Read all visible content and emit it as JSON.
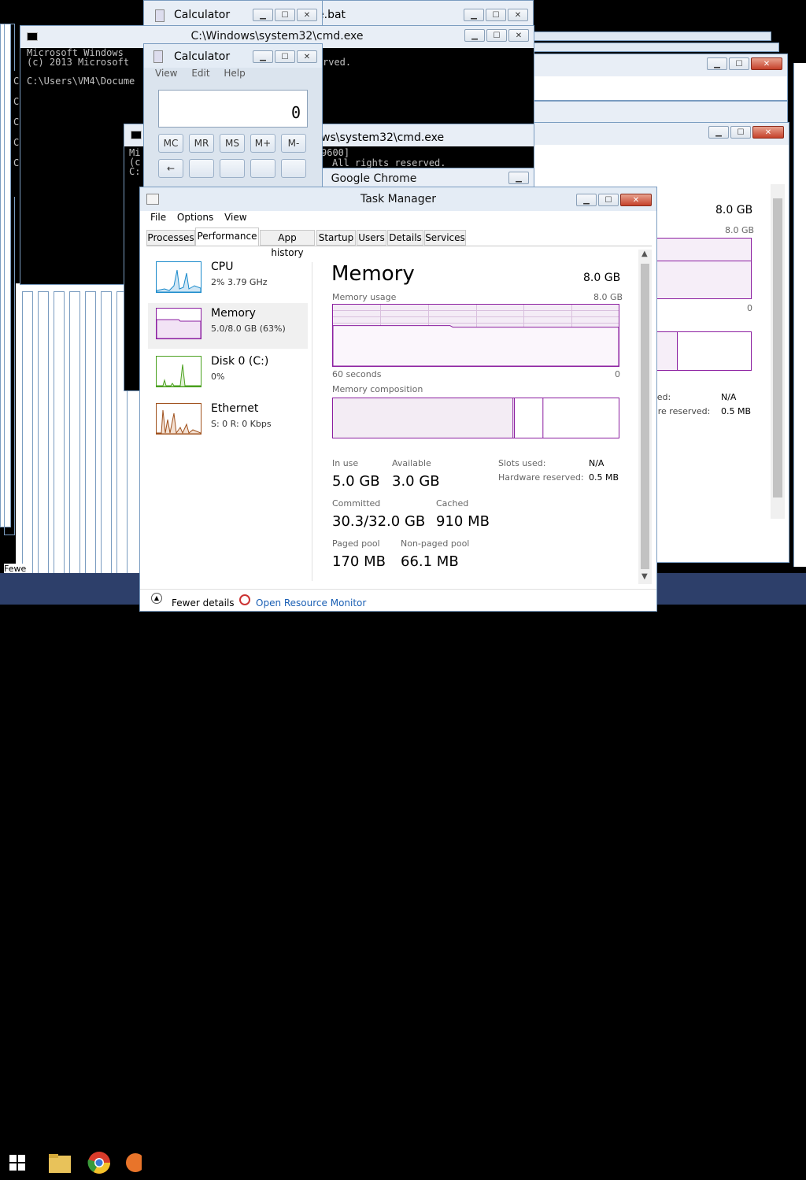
{
  "colors": {
    "accent": "#8b1ea0",
    "cpu": "#1a8acb",
    "disk": "#4aa01e",
    "ethernet": "#a0521e"
  },
  "background_windows": {
    "calc_back_title": "Calculator",
    "bat_title_fragment": "e.bat",
    "cmd1_title": "C:\\Windows\\system32\\cmd.exe",
    "cmd1_lines": [
      "Microsoft Windows",
      "(c) 2013 Microsoft",
      "",
      "C:\\Users\\VM4\\Docume"
    ],
    "cmd1_line2_tail": "rved.",
    "left_column_letters": [
      "C",
      "C",
      "C",
      "C",
      "C"
    ],
    "cmd2_title_fragment": "ws\\system32\\cmd.exe",
    "cmd2_lines": [
      "Mi",
      "(c",
      "C:"
    ],
    "cmd2_tail_1": "9600]",
    "cmd2_tail_2": "All rights reserved.",
    "chrome_title": "Google Chrome",
    "fewe_fragment": "Fewe",
    "right_tm": {
      "total": "8.0 GB",
      "max": "8.0 GB",
      "zero": "0",
      "slots_label": "sed:",
      "slots_value": "N/A",
      "hw_label": "are reserved:",
      "hw_value": "0.5 MB"
    }
  },
  "calculator": {
    "title": "Calculator",
    "menu": [
      "View",
      "Edit",
      "Help"
    ],
    "display": "0",
    "memory_buttons": [
      "MC",
      "MR",
      "MS",
      "M+",
      "M-"
    ],
    "back_button": "←"
  },
  "task_manager": {
    "title": "Task Manager",
    "menu": [
      "File",
      "Options",
      "View"
    ],
    "tabs": [
      "Processes",
      "Performance",
      "App history",
      "Startup",
      "Users",
      "Details",
      "Services"
    ],
    "active_tab": "Performance",
    "sidebar": [
      {
        "name": "CPU",
        "sub": "2%  3.79 GHz"
      },
      {
        "name": "Memory",
        "sub": "5.0/8.0 GB (63%)"
      },
      {
        "name": "Disk 0 (C:)",
        "sub": "0%"
      },
      {
        "name": "Ethernet",
        "sub": "S: 0  R: 0 Kbps"
      }
    ],
    "detail": {
      "heading": "Memory",
      "total": "8.0 GB",
      "usage_label": "Memory usage",
      "usage_max": "8.0 GB",
      "time_left": "60 seconds",
      "time_right": "0",
      "usage_fraction": 0.63,
      "composition_label": "Memory composition",
      "composition": {
        "in_use": 0.63,
        "modified": 0.005,
        "standby": 0.1,
        "free": 0.265
      },
      "stats": {
        "in_use_label": "In use",
        "in_use": "5.0 GB",
        "available_label": "Available",
        "available": "3.0 GB",
        "committed_label": "Committed",
        "committed": "30.3/32.0 GB",
        "cached_label": "Cached",
        "cached": "910 MB",
        "paged_label": "Paged pool",
        "paged": "170 MB",
        "nonpaged_label": "Non-paged pool",
        "nonpaged": "66.1 MB",
        "slots_label": "Slots used:",
        "slots": "N/A",
        "hw_label": "Hardware reserved:",
        "hw": "0.5 MB"
      }
    },
    "footer": {
      "fewer": "Fewer details",
      "resmon": "Open Resource Monitor"
    }
  }
}
